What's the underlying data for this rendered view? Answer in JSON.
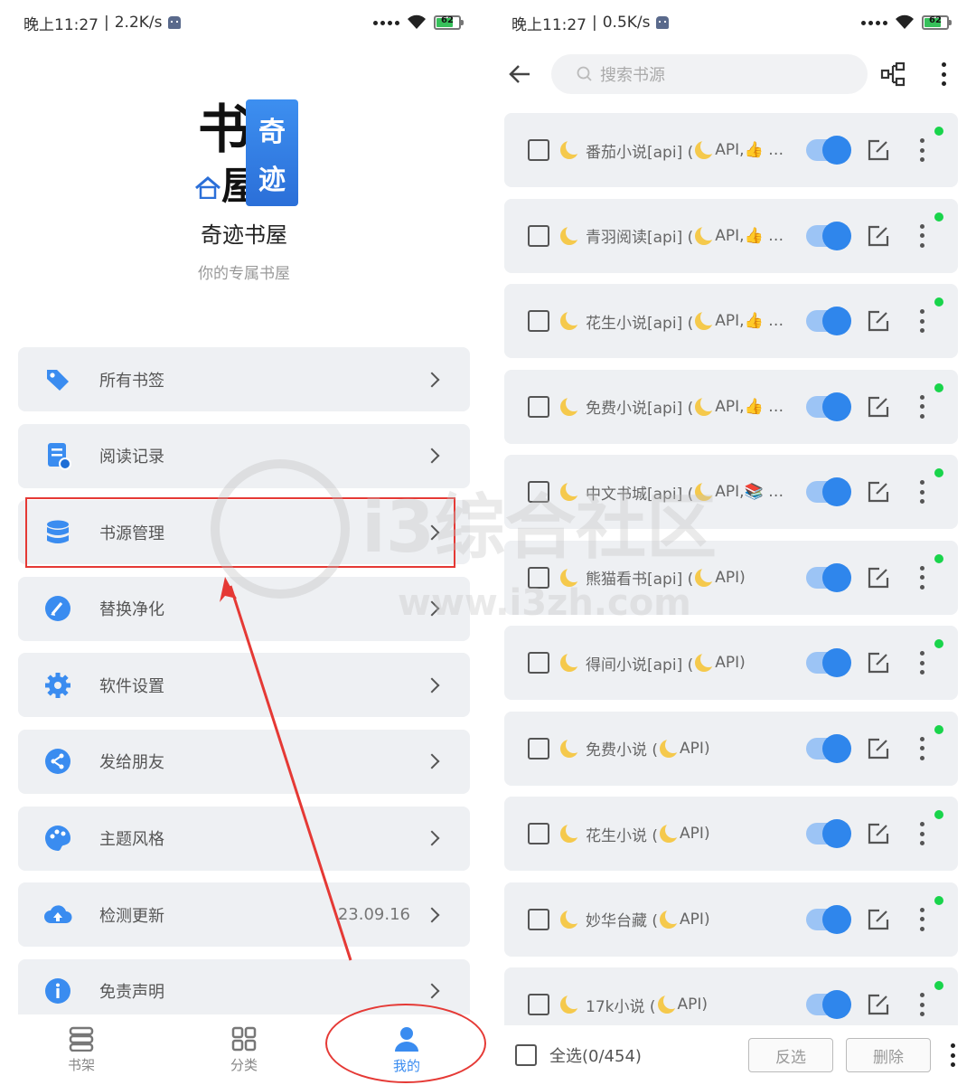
{
  "left": {
    "status": {
      "time": "晚上11:27",
      "speed": "2.2K/s",
      "battery": "62"
    },
    "app": {
      "name": "奇迹书屋",
      "subtitle": "你的专属书屋",
      "logo_chars": [
        "书",
        "屋",
        "奇",
        "迹"
      ]
    },
    "menu": [
      {
        "label": "所有书签",
        "icon": "tag-icon"
      },
      {
        "label": "阅读记录",
        "icon": "history-icon"
      },
      {
        "label": "书源管理",
        "icon": "database-icon",
        "highlighted": true
      },
      {
        "label": "替换净化",
        "icon": "brush-icon"
      },
      {
        "label": "软件设置",
        "icon": "gear-icon"
      },
      {
        "label": "发给朋友",
        "icon": "share-icon"
      },
      {
        "label": "主题风格",
        "icon": "palette-icon"
      },
      {
        "label": "检测更新",
        "icon": "cloud-upload-icon",
        "value": "23.09.16"
      },
      {
        "label": "免责声明",
        "icon": "info-icon"
      }
    ],
    "nav": [
      {
        "label": "书架",
        "icon": "bookshelf-icon"
      },
      {
        "label": "分类",
        "icon": "grid-icon"
      },
      {
        "label": "我的",
        "icon": "user-icon",
        "active": true
      }
    ]
  },
  "right": {
    "status": {
      "time": "晚上11:27",
      "speed": "0.5K/s",
      "battery": "62"
    },
    "search": {
      "placeholder": "搜索书源"
    },
    "sources": [
      {
        "name": "番茄小说[api] (",
        "tag": "API,👍 …"
      },
      {
        "name": "青羽阅读[api] (",
        "tag": "API,👍 …"
      },
      {
        "name": "花生小说[api] (",
        "tag": "API,👍 …"
      },
      {
        "name": "免费小说[api] (",
        "tag": "API,👍 …"
      },
      {
        "name": "中文书城[api] (",
        "tag": "API,📚 …"
      },
      {
        "name": "熊猫看书[api] (",
        "tag": "API)"
      },
      {
        "name": "得间小说[api] (",
        "tag": "API)"
      },
      {
        "name": "免费小说 (",
        "tag": "API)"
      },
      {
        "name": "花生小说 (",
        "tag": "API)"
      },
      {
        "name": "妙华台藏 (",
        "tag": "API)"
      },
      {
        "name": "17k小说 (",
        "tag": "API)"
      }
    ],
    "bottom": {
      "select_all": "全选(0/454)",
      "invert": "反选",
      "delete": "删除"
    }
  },
  "colors": {
    "accent": "#2f86ec",
    "highlight": "#e53935",
    "online": "#19d44b"
  },
  "watermark": {
    "text": "i3综合社区",
    "url": "www.i3zh.com"
  }
}
